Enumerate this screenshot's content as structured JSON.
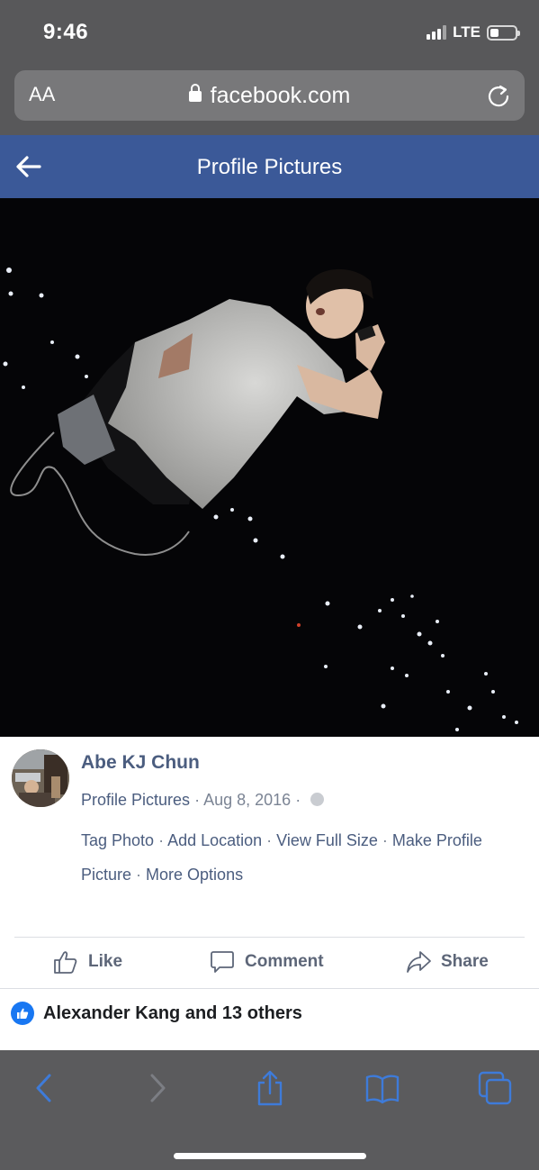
{
  "status_bar": {
    "time": "9:46",
    "network": "LTE"
  },
  "browser": {
    "text_size_label": "AA",
    "url": "facebook.com"
  },
  "header": {
    "title": "Profile Pictures"
  },
  "post": {
    "author": "Abe KJ Chun",
    "album": "Profile Pictures",
    "date": "Aug 8, 2016",
    "options": [
      "Tag Photo",
      "Add Location",
      "View Full Size",
      "Make Profile Picture",
      "More Options"
    ]
  },
  "actions": {
    "like": "Like",
    "comment": "Comment",
    "share": "Share"
  },
  "reactions": {
    "summary": "Alexander Kang and 13 others"
  },
  "colors": {
    "facebook_blue": "#3b5998",
    "link": "#4b5d7f",
    "safari_tint": "#3e7bd9"
  }
}
